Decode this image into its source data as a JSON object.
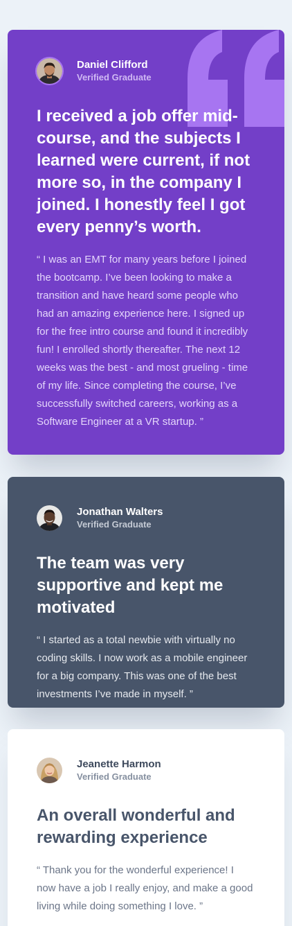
{
  "colors": {
    "page_background": "#ECF2F8",
    "purple_card": "#733FC8",
    "slate_card": "#48556A",
    "white_card": "#FFFFFF",
    "quote_mark": "#A775F1"
  },
  "testimonials": [
    {
      "name": "Daniel Clifford",
      "role": "Verified Graduate",
      "headline": "I received a job offer mid-course, and the subjects I learned were current, if not more so, in the company I joined. I honestly feel I got every penny’s worth.",
      "quote": "“ I was an EMT for many years before I joined the bootcamp. I’ve been looking to make a transition and have heard some people who had an amazing experience here. I signed up for the free intro course and found it incredibly fun! I enrolled shortly thereafter. The next 12 weeks was the best - and most grueling - time of my life. Since completing the course, I’ve successfully switched careers, working as a Software Engineer at a VR startup. ”",
      "avatar_icon": "avatar-daniel-icon",
      "decoration_icon": "quotation-mark-icon"
    },
    {
      "name": "Jonathan Walters",
      "role": "Verified Graduate",
      "headline": "The team was very supportive and kept me motivated",
      "quote": "“ I started as a total newbie with virtually no coding skills. I now work as a mobile engineer for a big company. This was one of the best investments I’ve made in myself. ”",
      "avatar_icon": "avatar-jonathan-icon"
    },
    {
      "name": "Jeanette Harmon",
      "role": "Verified Graduate",
      "headline": "An overall wonderful and rewarding experience",
      "quote": "“ Thank you for the wonderful experience! I now have a job I really enjoy, and make a good living while doing something I love. ”",
      "avatar_icon": "avatar-jeanette-icon"
    }
  ]
}
